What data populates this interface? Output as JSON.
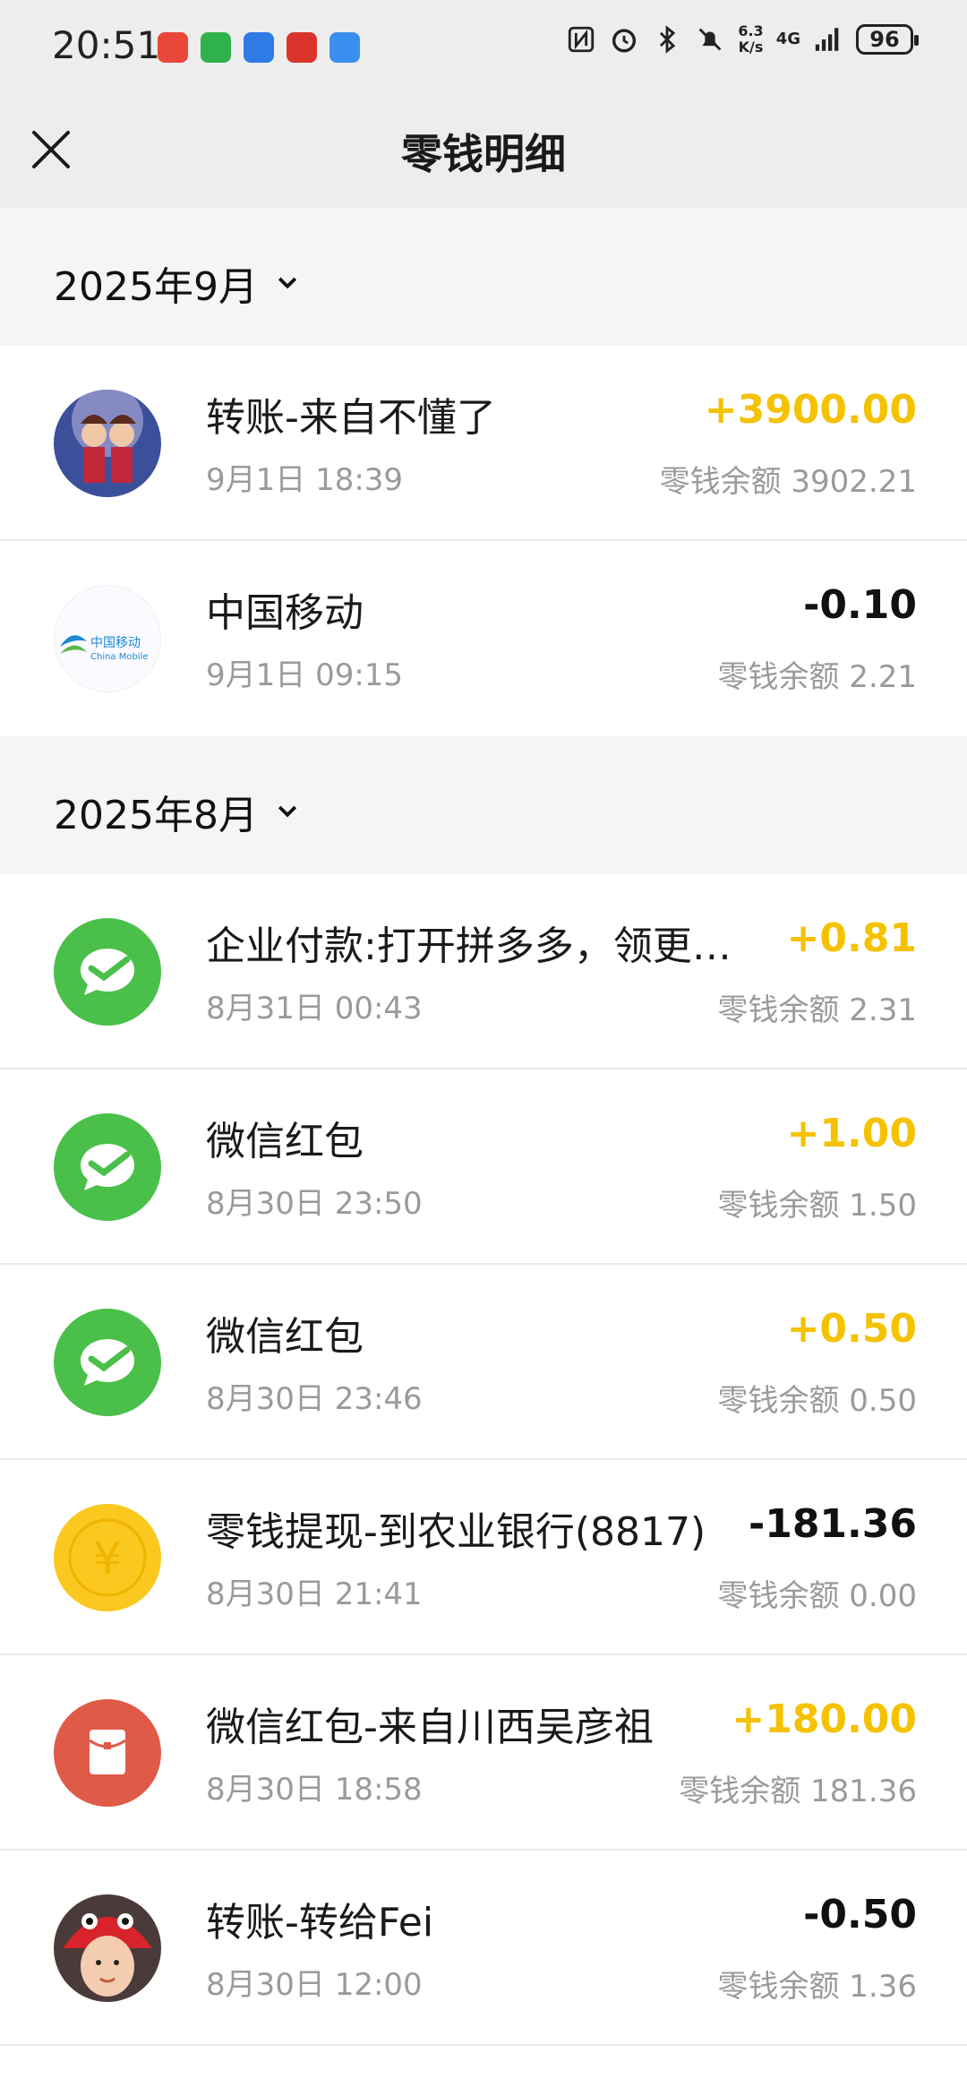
{
  "status": {
    "time": "20:51",
    "net_speed_top": "6.3",
    "net_speed_bottom": "K/s",
    "network": "4G",
    "battery": "96"
  },
  "header": {
    "title": "零钱明细"
  },
  "balance_label": "零钱余额",
  "sections": [
    {
      "month": "2025年9月",
      "rows": [
        {
          "title": "转账-来自不懂了",
          "time": "9月1日 18:39",
          "amount": "+3900.00",
          "balance": "零钱余额 3902.21",
          "icon": "user-avatar-icon"
        },
        {
          "title": "中国移动",
          "time": "9月1日 09:15",
          "amount": "-0.10",
          "balance": "零钱余额 2.21",
          "icon": "china-mobile-logo"
        }
      ]
    },
    {
      "month": "2025年8月",
      "rows": [
        {
          "title": "企业付款:打开拼多多，领更…",
          "time": "8月31日 00:43",
          "amount": "+0.81",
          "balance": "零钱余额 2.31",
          "icon": "wechat-pay-icon"
        },
        {
          "title": "微信红包",
          "time": "8月30日 23:50",
          "amount": "+1.00",
          "balance": "零钱余额 1.50",
          "icon": "wechat-pay-icon"
        },
        {
          "title": "微信红包",
          "time": "8月30日 23:46",
          "amount": "+0.50",
          "balance": "零钱余额 0.50",
          "icon": "wechat-pay-icon"
        },
        {
          "title": "零钱提现-到农业银行(8817)",
          "time": "8月30日 21:41",
          "amount": "-181.36",
          "balance": "零钱余额 0.00",
          "icon": "yuan-coin-icon"
        },
        {
          "title": "微信红包-来自川西吴彦祖",
          "time": "8月30日 18:58",
          "amount": "+180.00",
          "balance": "零钱余额 181.36",
          "icon": "red-packet-icon"
        },
        {
          "title": "转账-转给Fei",
          "time": "8月30日 12:00",
          "amount": "-0.50",
          "balance": "零钱余额 1.36",
          "icon": "user-avatar-icon"
        }
      ]
    }
  ],
  "china_mobile_logo_text": "中国移动",
  "china_mobile_logo_sub": "China Mobile",
  "coin_symbol": "¥",
  "colors": {
    "positive": "#f5c200",
    "wechat_green": "#4ac04a",
    "coin_yellow": "#fac81e",
    "red_packet": "#e05a48",
    "header_bg": "#ededed"
  }
}
